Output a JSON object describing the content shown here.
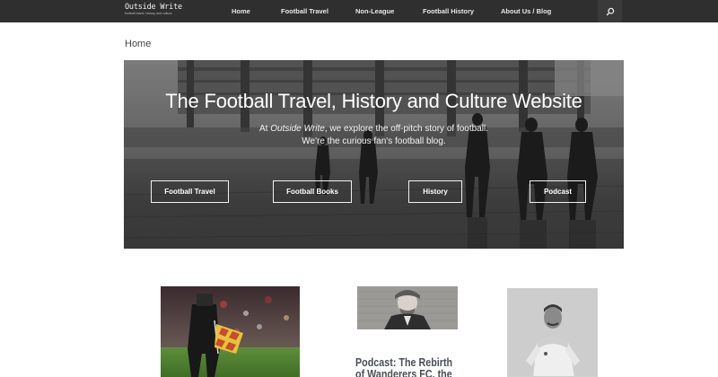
{
  "site": {
    "logo_title": "Outside Write",
    "logo_tagline": "football travel, history and culture"
  },
  "nav": {
    "items": [
      {
        "label": "Home"
      },
      {
        "label": "Football Travel"
      },
      {
        "label": "Non-League"
      },
      {
        "label": "Football History"
      },
      {
        "label": "About Us / Blog"
      }
    ],
    "search_icon": "search-icon"
  },
  "breadcrumb": "Home",
  "hero": {
    "title": "The Football Travel, History and Culture Website",
    "subtitle_prefix": "At ",
    "subtitle_brand": "Outside Write",
    "subtitle_suffix": ", we explore the off-pitch story of football.",
    "subtitle_line2": "We're the curious fan's football blog.",
    "buttons": [
      {
        "label": "Football Travel"
      },
      {
        "label": "Football Books"
      },
      {
        "label": "History"
      },
      {
        "label": "Podcast"
      }
    ]
  },
  "cards": [
    {
      "title_line1": "",
      "title_line2": ""
    },
    {
      "title_line1": "Podcast: The Rebirth",
      "title_line2": "of Wanderers FC, the"
    },
    {
      "title_line1": "",
      "title_line2": ""
    }
  ],
  "colors": {
    "topbar": "#2f2f2f",
    "title_text": "#4a4f57"
  }
}
